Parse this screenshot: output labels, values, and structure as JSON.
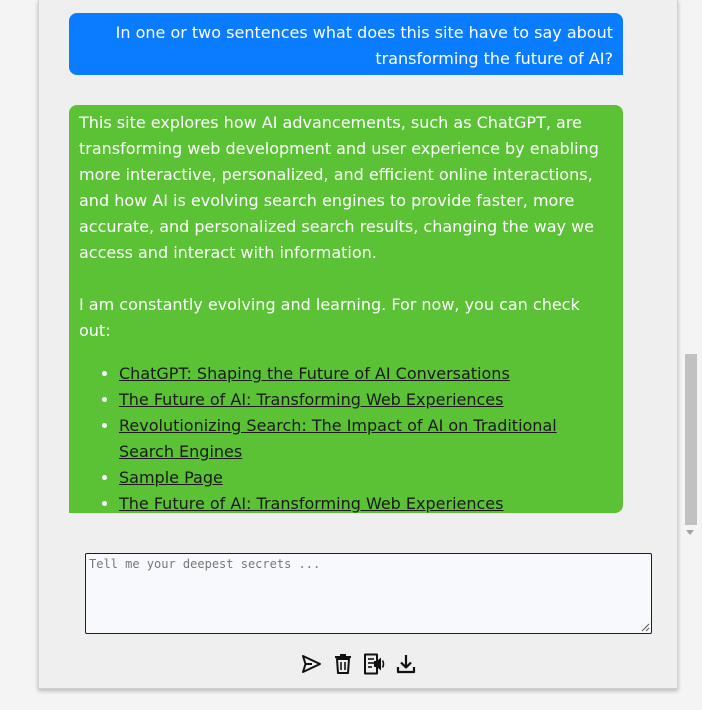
{
  "conversation": {
    "user_message": "In one or two sentences what does this site have to say about transforming the future of AI?",
    "bot_message": {
      "summary": "This site explores how AI advancements, such as ChatGPT, are transforming web development and user experience by enabling more interactive, personalized, and efficient online interactions, and how AI is evolving search engines to provide faster, more accurate, and personalized search results, changing the way we access and interact with information.",
      "followup": "I am constantly evolving and learning. For now, you can check out:",
      "links": [
        "ChatGPT: Shaping the Future of AI Conversations",
        "The Future of AI: Transforming Web Experiences",
        "Revolutionizing Search: The Impact of AI on Traditional Search Engines",
        "Sample Page",
        "The Future of AI: Transforming Web Experiences"
      ]
    }
  },
  "input": {
    "placeholder": "Tell me your deepest secrets ...",
    "value": ""
  },
  "toolbar": {
    "icons": [
      "send-icon",
      "trash-icon",
      "read-aloud-icon",
      "download-icon"
    ]
  },
  "colors": {
    "user_bubble": "#0a7cff",
    "bot_bubble": "#5bc236",
    "link_text": "#1a1a1a"
  }
}
